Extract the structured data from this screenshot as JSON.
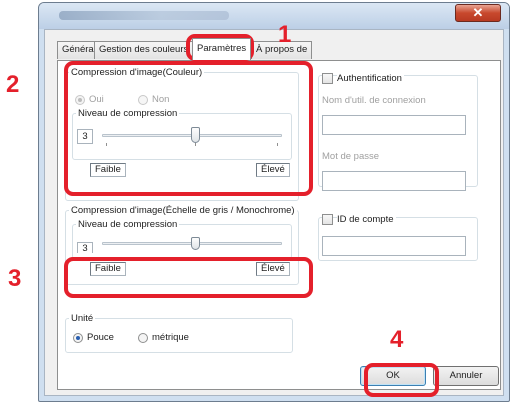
{
  "window": {
    "close_glyph": "✕"
  },
  "tabs": [
    {
      "label": "Général"
    },
    {
      "label": "Gestion des couleurs"
    },
    {
      "label": "Paramètres"
    },
    {
      "label": "À propos de"
    }
  ],
  "color_group": {
    "legend": "Compression d'image(Couleur)",
    "radio_oui": "Oui",
    "radio_non": "Non",
    "level_legend": "Niveau de compression",
    "level_value": "3",
    "low_label": "Faible",
    "high_label": "Élevé"
  },
  "gray_group": {
    "legend": "Compression d'image(Échelle de gris / Monochrome)",
    "level_legend": "Niveau de compression",
    "level_value": "3",
    "low_label": "Faible",
    "high_label": "Élevé"
  },
  "unit_group": {
    "legend": "Unité",
    "option_pouce": "Pouce",
    "option_metrique": "métrique"
  },
  "auth": {
    "checkbox_label": "Authentification",
    "username_label": "Nom d'util. de connexion",
    "password_label": "Mot de passe"
  },
  "account": {
    "checkbox_label": "ID de compte"
  },
  "buttons": {
    "ok": "OK",
    "cancel": "Annuler"
  },
  "callouts": {
    "c1": "1",
    "c2": "2",
    "c3": "3",
    "c4": "4"
  },
  "colors": {
    "highlight": "#e4202b",
    "selected_radio": "#2a5fb0"
  }
}
